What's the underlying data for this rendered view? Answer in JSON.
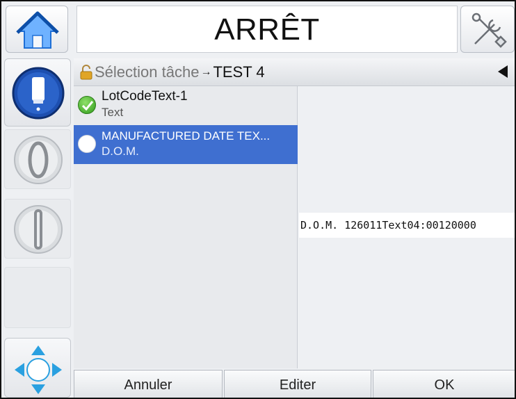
{
  "header": {
    "title": "ARRÊT",
    "home_icon": "home-icon",
    "tools_icon": "tools-icon"
  },
  "sidebar": {
    "buttons": [
      {
        "name": "ink-icon"
      },
      {
        "name": "stop-circle-icon"
      },
      {
        "name": "start-line-icon"
      },
      {
        "name": "navigation-arrows-icon"
      }
    ]
  },
  "breadcrumb": {
    "prefix": "Sélection tâche",
    "separator": "→",
    "current": "TEST 4"
  },
  "fields": [
    {
      "name": "LotCodeText-1",
      "type": "Text",
      "status": "checked",
      "selected": false
    },
    {
      "name": "MANUFACTURED DATE TEX...",
      "type": "D.O.M.",
      "status": "empty",
      "selected": true
    }
  ],
  "preview": {
    "text": "D.O.M. 126011Text04:00120000"
  },
  "footer": {
    "cancel_label": "Annuler",
    "edit_label": "Editer",
    "ok_label": "OK"
  },
  "colors": {
    "selection": "#3f6fd0",
    "check": "#2f9b1a",
    "home_roof": "#1e6fd6"
  }
}
